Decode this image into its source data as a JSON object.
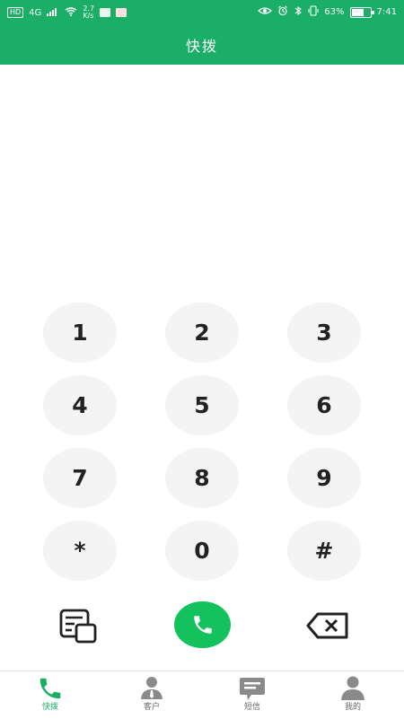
{
  "status": {
    "left": {
      "hd": "HD",
      "network": "4G",
      "speed_value": "2.7",
      "speed_unit": "K/s"
    },
    "right": {
      "battery_percent": "63%",
      "time": "7:41"
    }
  },
  "header": {
    "title": "快拨"
  },
  "dialpad": {
    "keys": [
      "1",
      "2",
      "3",
      "4",
      "5",
      "6",
      "7",
      "8",
      "9",
      "*",
      "0",
      "#"
    ]
  },
  "icons": {
    "contacts": "contacts-card-icon",
    "call": "phone-call-icon",
    "backspace": "backspace-icon"
  },
  "bottom_nav": {
    "items": [
      {
        "label": "快拨",
        "icon": "phone-icon",
        "active": true
      },
      {
        "label": "客户",
        "icon": "customer-icon",
        "active": false
      },
      {
        "label": "短信",
        "icon": "sms-icon",
        "active": false
      },
      {
        "label": "我的",
        "icon": "profile-icon",
        "active": false
      }
    ]
  },
  "colors": {
    "brand": "#1aae66",
    "call": "#13c15d",
    "key_bg": "#f4f4f4",
    "icon_inactive": "#8a8a8a"
  }
}
